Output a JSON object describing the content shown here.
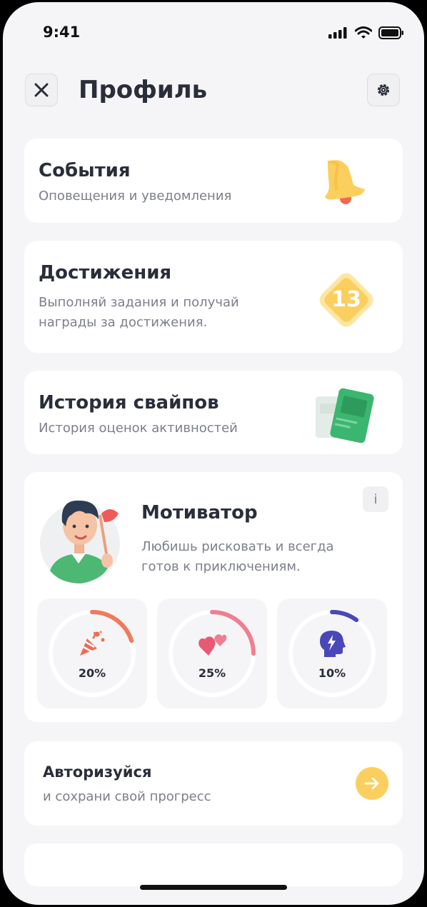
{
  "status_bar": {
    "time": "9:41"
  },
  "header": {
    "title": "Профиль"
  },
  "cards": {
    "events": {
      "title": "События",
      "subtitle": "Оповещения и уведомления"
    },
    "achievements": {
      "title": "Достижения",
      "subtitle_line1": "Выполняй задания и получай",
      "subtitle_line2": "награды за достижения.",
      "badge_value": "13"
    },
    "swipe_history": {
      "title": "История свайпов",
      "subtitle": "История оценок активностей"
    }
  },
  "motivator": {
    "title": "Мотиватор",
    "info_label": "i",
    "desc_line1": "Любишь рисковать и всегда",
    "desc_line2": "готов к приключениям.",
    "stats": [
      {
        "icon": "party-popper-icon",
        "percent_label": "20%",
        "value": 0.2,
        "color": "#f07a5c"
      },
      {
        "icon": "hearts-icon",
        "percent_label": "25%",
        "value": 0.25,
        "color": "#ef7e92"
      },
      {
        "icon": "brain-lightning-icon",
        "percent_label": "10%",
        "value": 0.1,
        "color": "#4a47b8"
      }
    ]
  },
  "auth": {
    "title": "Авторизуйся",
    "subtitle": "и сохрани свой прогресс"
  },
  "colors": {
    "accent_yellow": "#fbcf5e",
    "background": "#f5f5f7",
    "card": "#ffffff",
    "text": "#2a2d3a",
    "muted": "#7c7f8a"
  }
}
